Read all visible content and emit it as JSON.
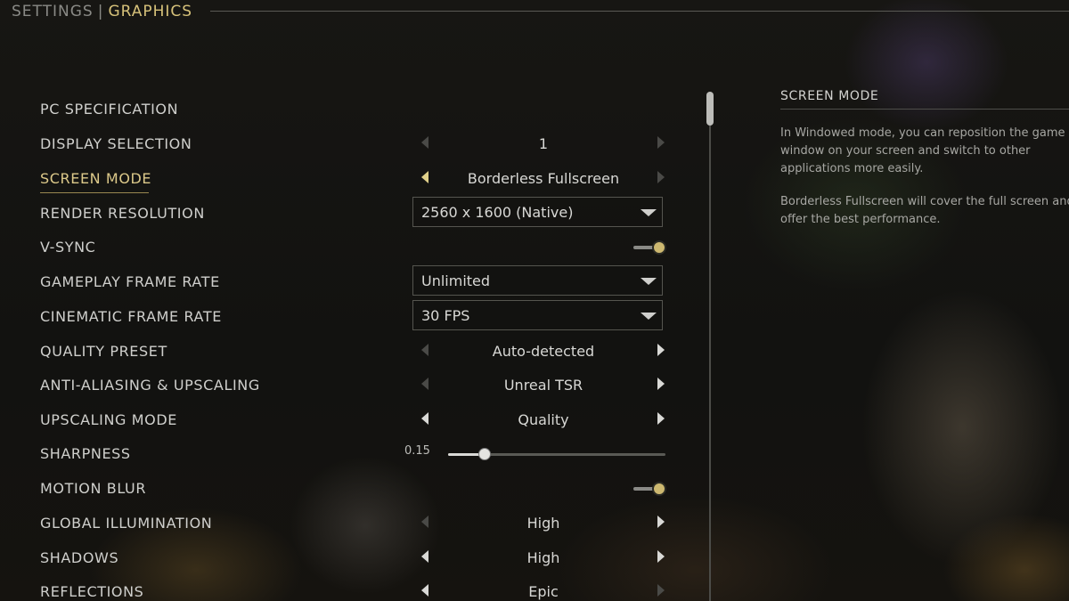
{
  "header": {
    "settings": "SETTINGS",
    "separator": "|",
    "graphics": "GRAPHICS"
  },
  "rows": [
    {
      "label": "PC SPECIFICATION",
      "type": "link"
    },
    {
      "label": "DISPLAY SELECTION",
      "type": "selector",
      "value": "1"
    },
    {
      "label": "SCREEN MODE",
      "type": "selector",
      "value": "Borderless Fullscreen",
      "selected": true
    },
    {
      "label": "RENDER RESOLUTION",
      "type": "dropdown",
      "value": "2560 x 1600 (Native)"
    },
    {
      "label": "V-SYNC",
      "type": "toggle",
      "value": "on"
    },
    {
      "label": "GAMEPLAY FRAME RATE",
      "type": "dropdown",
      "value": "Unlimited"
    },
    {
      "label": "CINEMATIC FRAME RATE",
      "type": "dropdown",
      "value": "30 FPS"
    },
    {
      "label": "QUALITY PRESET",
      "type": "selector",
      "value": "Auto-detected"
    },
    {
      "label": "ANTI-ALIASING & UPSCALING",
      "type": "selector",
      "value": "Unreal TSR"
    },
    {
      "label": "UPSCALING MODE",
      "type": "selector",
      "value": "Quality"
    },
    {
      "label": "SHARPNESS",
      "type": "slider",
      "value": "0.15",
      "fraction": 0.17
    },
    {
      "label": "MOTION BLUR",
      "type": "toggle",
      "value": "on"
    },
    {
      "label": "GLOBAL ILLUMINATION",
      "type": "selector",
      "value": "High"
    },
    {
      "label": "SHADOWS",
      "type": "selector",
      "value": "High"
    },
    {
      "label": "REFLECTIONS",
      "type": "selector",
      "value": "Epic"
    }
  ],
  "info": {
    "title": "SCREEN MODE",
    "paragraph1": "In Windowed mode, you can reposition the game window on your screen and switch to other applications more easily.",
    "paragraph2": "Borderless Fullscreen will cover the full screen and offer the best performance."
  },
  "colors": {
    "accent": "#d7c27a",
    "text": "#cfcfcc",
    "muted": "#8a8a86"
  }
}
